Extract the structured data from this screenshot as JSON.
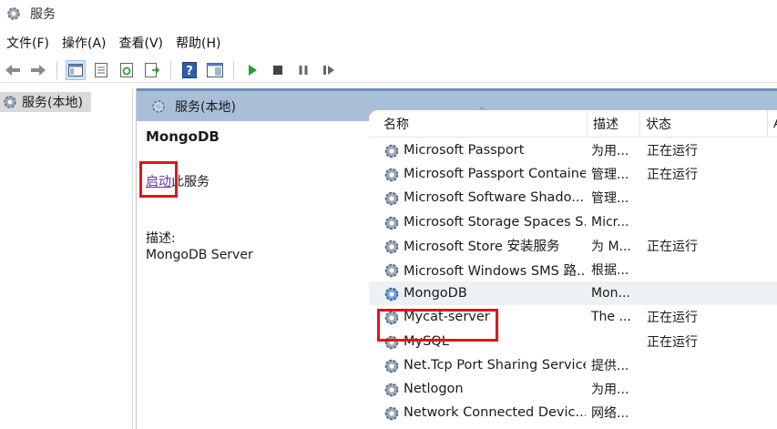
{
  "window": {
    "title": "服务",
    "icon": "gear-icon"
  },
  "menu": [
    {
      "label": "文件(F)"
    },
    {
      "label": "操作(A)"
    },
    {
      "label": "查看(V)"
    },
    {
      "label": "帮助(H)"
    }
  ],
  "toolbar": {
    "icons": [
      "back-arrow-icon",
      "forward-arrow-icon",
      "console-tree-icon",
      "properties-icon",
      "refresh-icon",
      "export-list-icon",
      "help-icon",
      "view-icon",
      "start-icon",
      "stop-icon",
      "pause-icon",
      "restart-icon"
    ],
    "active": "console-tree-icon"
  },
  "tree": {
    "item_label": "服务(本地)"
  },
  "main": {
    "header_title": "服务(本地)",
    "detail": {
      "service_name": "MongoDB",
      "action_link": "启动",
      "action_suffix": "此服务",
      "description_label": "描述:",
      "description": "MongoDB Server"
    },
    "columns": {
      "name": "名称",
      "description": "描述",
      "status": "状态",
      "extra": "Æ"
    },
    "rows": [
      {
        "name": "Microsoft Passport",
        "description": "为用...",
        "status": "正在运行"
      },
      {
        "name": "Microsoft Passport Container",
        "description": "管理...",
        "status": "正在运行"
      },
      {
        "name": "Microsoft Software Shado...",
        "description": "管理...",
        "status": ""
      },
      {
        "name": "Microsoft Storage Spaces S...",
        "description": "Micr...",
        "status": ""
      },
      {
        "name": "Microsoft Store 安装服务",
        "description": "为 M...",
        "status": "正在运行"
      },
      {
        "name": "Microsoft Windows SMS 路...",
        "description": "根据...",
        "status": ""
      },
      {
        "name": "MongoDB",
        "description": "Mon...",
        "status": ""
      },
      {
        "name": "Mycat-server",
        "description": "The ...",
        "status": "正在运行"
      },
      {
        "name": "MySQL",
        "description": "",
        "status": "正在运行"
      },
      {
        "name": "Net.Tcp Port Sharing Service",
        "description": "提供...",
        "status": ""
      },
      {
        "name": "Netlogon",
        "description": "为用...",
        "status": ""
      },
      {
        "name": "Network Connected Devic...",
        "description": "网络...",
        "status": ""
      }
    ],
    "selected_row": "MongoDB"
  },
  "colors": {
    "header_bg": "#a9bfd8",
    "highlight": "#e0141e",
    "link": "#6b2fa1"
  }
}
